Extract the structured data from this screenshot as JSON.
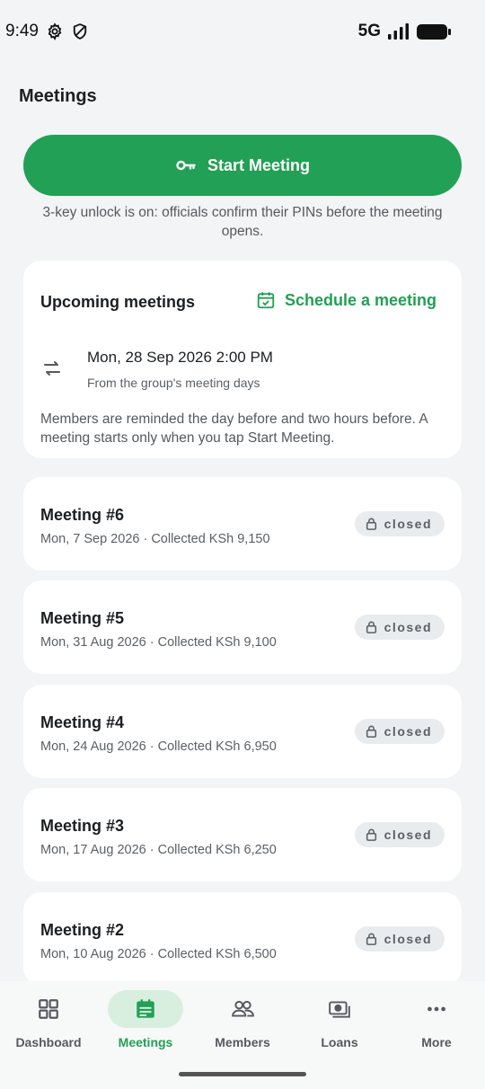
{
  "status_bar": {
    "time": "9:49",
    "network": "5G",
    "icons": [
      "gear-icon",
      "shield-icon",
      "signal-icon",
      "battery-icon"
    ]
  },
  "page": {
    "title": "Meetings"
  },
  "start_meeting": {
    "label": "Start Meeting",
    "icon": "key-icon",
    "note": "3-key unlock is on: officials confirm their PINs before the meeting opens."
  },
  "upcoming": {
    "title": "Upcoming meetings",
    "schedule_label": "Schedule a meeting",
    "next_date": "Mon, 28 Sep 2026 2:00 PM",
    "next_source": "From the group's meeting days",
    "reminder_note": "Members are reminded the day before and two hours before. A meeting starts only when you tap Start Meeting."
  },
  "meetings": [
    {
      "title": "Meeting #6",
      "subtitle": "Mon, 7 Sep 2026 · Collected KSh 9,150",
      "status": "closed"
    },
    {
      "title": "Meeting #5",
      "subtitle": "Mon, 31 Aug 2026 · Collected KSh 9,100",
      "status": "closed"
    },
    {
      "title": "Meeting #4",
      "subtitle": "Mon, 24 Aug 2026 · Collected KSh 6,950",
      "status": "closed"
    },
    {
      "title": "Meeting #3",
      "subtitle": "Mon, 17 Aug 2026 · Collected KSh 6,250",
      "status": "closed"
    },
    {
      "title": "Meeting #2",
      "subtitle": "Mon, 10 Aug 2026 · Collected KSh 6,500",
      "status": "closed"
    }
  ],
  "nav": {
    "active": "Meetings",
    "items": [
      {
        "label": "Dashboard",
        "icon": "grid-icon"
      },
      {
        "label": "Meetings",
        "icon": "calendar-icon"
      },
      {
        "label": "Members",
        "icon": "people-icon"
      },
      {
        "label": "Loans",
        "icon": "money-icon"
      },
      {
        "label": "More",
        "icon": "more-icon"
      }
    ]
  },
  "colors": {
    "accent": "#22a055",
    "background": "#f2f4f5",
    "card": "#ffffff",
    "badge": "#e9ecee"
  }
}
